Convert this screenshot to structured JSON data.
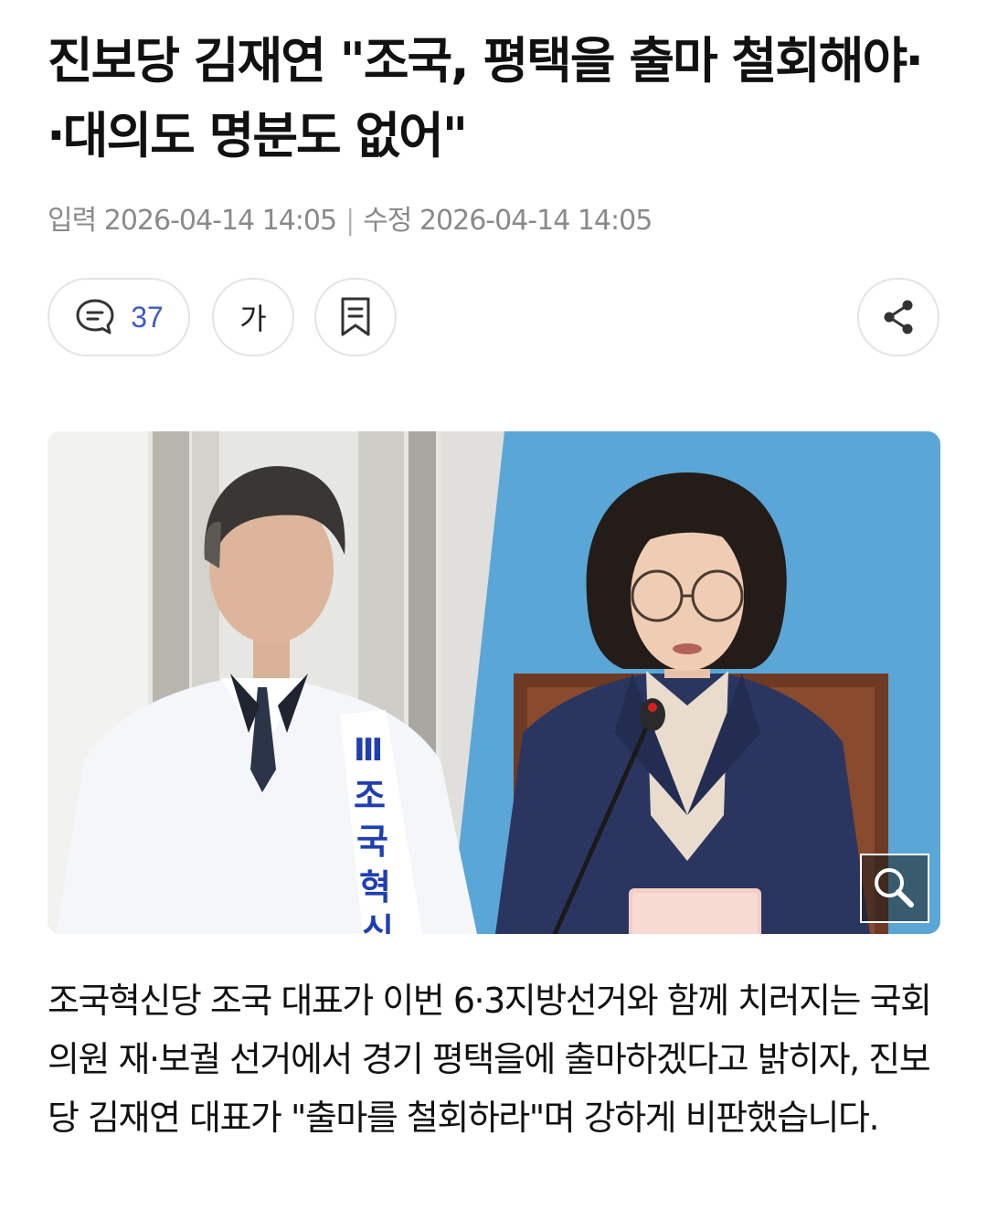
{
  "article": {
    "title": "진보당 김재연 \"조국, 평택을 출마 철회해야‧ ‧대의도 명분도 없어\"",
    "published_label": "입력",
    "published_at": "2026-04-14 14:05",
    "updated_label": "수정",
    "updated_at": "2026-04-14 14:05",
    "body": "조국혁신당 조국 대표가 이번 6·3지방선거와 함께 치러지는 국회의원 재·보궐 선거에서 경기 평택을에 출마하겠다고 밝히자, 진보당 김재연 대표가 \"출마를 철회하라\"며 강하게 비판했습니다."
  },
  "toolbar": {
    "comment_icon": "comment-icon",
    "comment_count": "37",
    "font_size_label": "가",
    "bookmark_icon": "bookmark-icon",
    "share_icon": "share-icon"
  },
  "photo": {
    "vest_text": "조국혁신",
    "zoom_icon": "magnifier-icon"
  },
  "colors": {
    "comment_count": "#3f5bc6",
    "photo_right_bg": "#5aa6d6",
    "vest_text": "#1f3fb0"
  }
}
